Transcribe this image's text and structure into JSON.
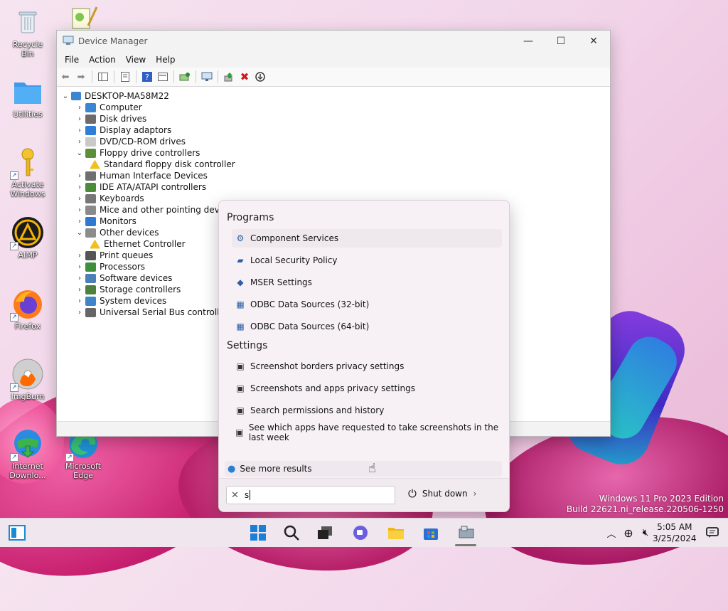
{
  "desktop": {
    "icons": [
      {
        "label": "Recycle Bin"
      },
      {
        "label": "Utilities"
      },
      {
        "label": "Activate Windows"
      },
      {
        "label": "AIMP"
      },
      {
        "label": "Firefox"
      },
      {
        "label": "ImgBurn"
      },
      {
        "label": "Internet Downlo..."
      },
      {
        "label": "Microsoft Edge"
      }
    ],
    "watermark": {
      "line1": "Windows 11 Pro 2023 Edition",
      "line2": "Build 22621.ni_release.220506-1250"
    }
  },
  "window": {
    "title": "Device Manager",
    "controls": {
      "minimize": "—",
      "maximize": "☐",
      "close": "✕"
    },
    "menu": [
      "File",
      "Action",
      "View",
      "Help"
    ],
    "tree": {
      "root": "DESKTOP-MA58M22",
      "items": [
        {
          "label": "Computer",
          "expanded": false,
          "color": "#3a86d1"
        },
        {
          "label": "Disk drives",
          "expanded": false,
          "color": "#6b6b6b"
        },
        {
          "label": "Display adaptors",
          "expanded": false,
          "color": "#2e7dd6"
        },
        {
          "label": "DVD/CD-ROM drives",
          "expanded": false,
          "color": "#c9c9c9"
        },
        {
          "label": "Floppy drive controllers",
          "expanded": true,
          "color": "#5b8f3a"
        },
        {
          "label": "Standard floppy disk controller",
          "child": true,
          "color": "#f0c020"
        },
        {
          "label": "Human Interface Devices",
          "expanded": false,
          "color": "#6f6f6f"
        },
        {
          "label": "IDE ATA/ATAPI controllers",
          "expanded": false,
          "color": "#4c8b3a"
        },
        {
          "label": "Keyboards",
          "expanded": false,
          "color": "#777777"
        },
        {
          "label": "Mice and other pointing devices",
          "expanded": false,
          "color": "#8a8a8a"
        },
        {
          "label": "Monitors",
          "expanded": false,
          "color": "#2f79d0"
        },
        {
          "label": "Other devices",
          "expanded": true,
          "color": "#8c8c8c"
        },
        {
          "label": "Ethernet Controller",
          "child": true,
          "color": "#f0c020"
        },
        {
          "label": "Print queues",
          "expanded": false,
          "color": "#555555"
        },
        {
          "label": "Processors",
          "expanded": false,
          "color": "#3e8e3e"
        },
        {
          "label": "Software devices",
          "expanded": false,
          "color": "#4a7fb8"
        },
        {
          "label": "Storage controllers",
          "expanded": false,
          "color": "#4f7f3f"
        },
        {
          "label": "System devices",
          "expanded": false,
          "color": "#3f84c8"
        },
        {
          "label": "Universal Serial Bus controllers",
          "expanded": false,
          "color": "#666666"
        }
      ]
    }
  },
  "search": {
    "programs_heading": "Programs",
    "programs": [
      {
        "label": "Component Services",
        "icon": "component-services-icon",
        "glyph": "⚙"
      },
      {
        "label": "Local Security Policy",
        "icon": "security-policy-icon",
        "glyph": "▰"
      },
      {
        "label": "MSER Settings",
        "icon": "mser-icon",
        "glyph": "◆"
      },
      {
        "label": "ODBC Data Sources (32-bit)",
        "icon": "odbc-icon",
        "glyph": "▦"
      },
      {
        "label": "ODBC Data Sources (64-bit)",
        "icon": "odbc-icon",
        "glyph": "▦"
      }
    ],
    "settings_heading": "Settings",
    "settings": [
      {
        "label": "Screenshot borders privacy settings",
        "icon": "screenshot-icon",
        "glyph": "▣"
      },
      {
        "label": "Screenshots and apps privacy settings",
        "icon": "screenshot-icon",
        "glyph": "▣"
      },
      {
        "label": "Search permissions and history",
        "icon": "shield-icon",
        "glyph": "▣"
      },
      {
        "label": "See which apps have requested to take screenshots in the last week",
        "icon": "screenshot-icon",
        "glyph": "▣"
      }
    ],
    "more_results": "See more results",
    "query": "s",
    "shutdown_label": "Shut down"
  },
  "taskbar": {
    "time": "5:05 AM",
    "date": "3/25/2024"
  }
}
